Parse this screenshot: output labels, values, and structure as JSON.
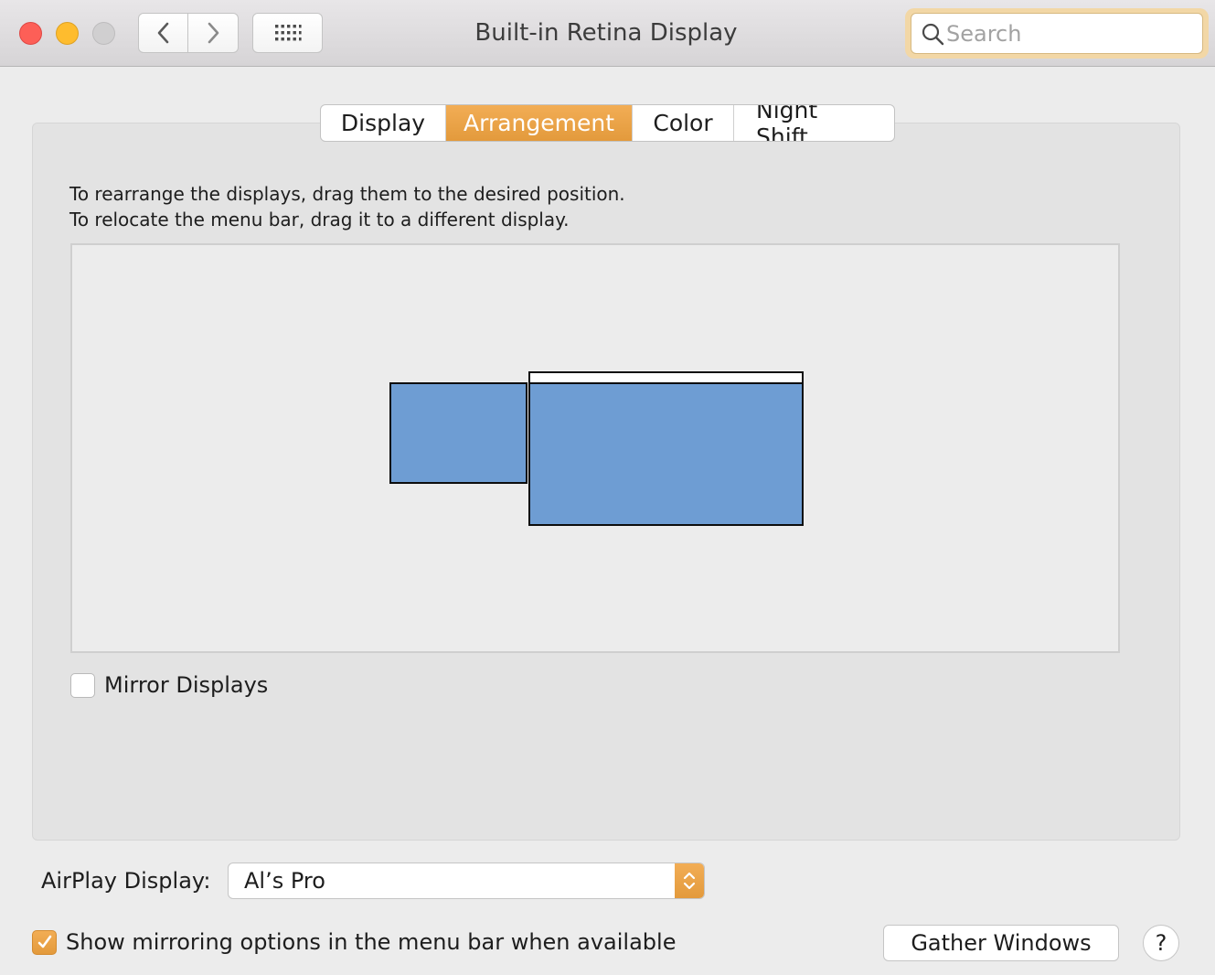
{
  "window": {
    "title": "Built-in Retina Display"
  },
  "toolbar": {
    "back_icon": "chevron-left-icon",
    "forward_icon": "chevron-right-icon",
    "show_all_icon": "grid-icon"
  },
  "search": {
    "placeholder": "Search",
    "value": ""
  },
  "tabs": [
    {
      "label": "Display",
      "active": false
    },
    {
      "label": "Arrangement",
      "active": true
    },
    {
      "label": "Color",
      "active": false
    },
    {
      "label": "Night Shift",
      "active": false
    }
  ],
  "arrangement": {
    "instruction_line1": "To rearrange the displays, drag them to the desired position.",
    "instruction_line2": "To relocate the menu bar, drag it to a different display.",
    "display_color": "#6e9dd3"
  },
  "mirror": {
    "label": "Mirror Displays",
    "checked": false
  },
  "airplay": {
    "label": "AirPlay Display:",
    "selected": "Al’s Pro"
  },
  "show_mirroring": {
    "label": "Show mirroring options in the menu bar when available",
    "checked": true
  },
  "buttons": {
    "gather_windows": "Gather Windows",
    "help": "?"
  },
  "colors": {
    "accent": "#e9a046",
    "close": "#fd5f57",
    "minimize": "#febc2e",
    "zoom_disabled": "#d0cfd0"
  }
}
